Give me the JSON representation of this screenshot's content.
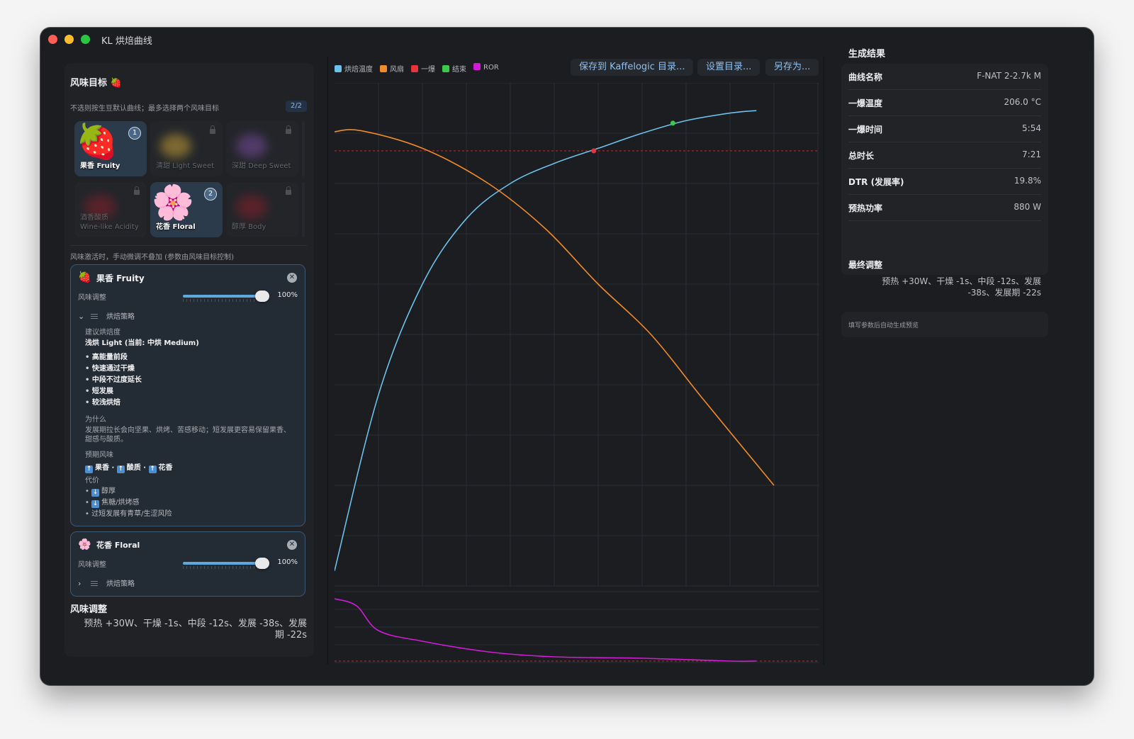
{
  "window": {
    "title": "KL 烘焙曲线"
  },
  "left": {
    "title": "风味目标",
    "title_emoji": "🍓",
    "hint": "不选则按生豆默认曲线；最多选择两个风味目标",
    "count": "2/2",
    "tiles": [
      {
        "label": "果香 Fruity",
        "emoji": "🍓",
        "state": "selected",
        "order": "1"
      },
      {
        "label": "清甜 Light Sweet",
        "state": "locked",
        "color": "#c9a23a"
      },
      {
        "label": "深甜 Deep Sweet",
        "state": "locked",
        "color": "#7a4fa0"
      },
      {
        "label_line1": "酒香酸质",
        "label_line2": "Wine-like Acidity",
        "state": "locked",
        "color": "#8a2230"
      },
      {
        "label": "花香 Floral",
        "emoji": "🌸",
        "state": "selected",
        "order": "2"
      },
      {
        "label": "醇厚 Body",
        "state": "locked",
        "color": "#8a2230"
      }
    ],
    "active_hint": "风味激活时，手动微调不叠加 (参数由风味目标控制)",
    "cards": {
      "fruity": {
        "emoji": "🍓",
        "title": "果香 Fruity",
        "slider_label": "风味调整",
        "slider_value": "100%",
        "strategy_label": "烘焙策略",
        "suggest_label": "建议烘焙度",
        "suggest_value": "浅烘 Light (当前: 中烘 Medium)",
        "bullets": [
          "高能量前段",
          "快速通过干燥",
          "中段不过度延长",
          "短发展",
          "较浅烘焙"
        ],
        "why_label": "为什么",
        "why_text": "发展期拉长会向坚果、烘烤、苦感移动；短发展更容易保留果香、甜感与酸质。",
        "expected_label": "预期风味",
        "expected": [
          "果香",
          "酸质",
          "花香"
        ],
        "cost_label": "代价",
        "costs": [
          "醇厚",
          "焦糖/烘烤感",
          "过短发展有青草/生涩风险"
        ]
      },
      "floral": {
        "emoji": "🌸",
        "title": "花香 Floral",
        "slider_label": "风味调整",
        "slider_value": "100%",
        "strategy_label": "烘焙策略"
      }
    },
    "adjust_title": "风味调整",
    "adjust_text": "预热 +30W、干燥 -1s、中段 -12s、发展 -38s、发展期 -22s"
  },
  "toolbar": {
    "legend": [
      {
        "label": "烘焙温度",
        "color": "#6cc0ec"
      },
      {
        "label": "风扇",
        "color": "#f08a2a"
      },
      {
        "label": "一爆",
        "color": "#e8333a"
      },
      {
        "label": "结束",
        "color": "#3cc84a"
      },
      {
        "label": "ROR",
        "color": "#d21ad8"
      }
    ],
    "save_kaffelogic": "保存到 Kaffelogic 目录...",
    "set_dir": "设置目录...",
    "save_as": "另存为..."
  },
  "chart_data": {
    "type": "line",
    "x_unit": "time",
    "x_grid_lines": 11,
    "total_time": "7:21",
    "first_crack_time": "5:54",
    "series": [
      {
        "name": "烘焙温度",
        "color": "#6cc0ec",
        "points": [
          [
            0,
            0.03
          ],
          [
            0.1,
            0.38
          ],
          [
            0.2,
            0.6
          ],
          [
            0.3,
            0.73
          ],
          [
            0.4,
            0.8
          ],
          [
            0.5,
            0.84
          ],
          [
            0.6,
            0.87
          ],
          [
            0.7,
            0.9
          ],
          [
            0.8,
            0.925
          ],
          [
            0.9,
            0.94
          ],
          [
            0.96,
            0.945
          ]
        ]
      },
      {
        "name": "风扇",
        "color": "#f08a2a",
        "points": [
          [
            0,
            0.903
          ],
          [
            0.06,
            0.905
          ],
          [
            0.2,
            0.87
          ],
          [
            0.35,
            0.8
          ],
          [
            0.48,
            0.71
          ],
          [
            0.6,
            0.6
          ],
          [
            0.72,
            0.5
          ],
          [
            0.84,
            0.37
          ],
          [
            1.0,
            0.2
          ]
        ]
      },
      {
        "name": "ROR",
        "color": "#d21ad8",
        "points": [
          [
            0,
            0.9
          ],
          [
            0.05,
            0.8
          ],
          [
            0.1,
            0.45
          ],
          [
            0.2,
            0.3
          ],
          [
            0.35,
            0.15
          ],
          [
            0.5,
            0.08
          ],
          [
            0.7,
            0.06
          ],
          [
            0.9,
            0.02
          ],
          [
            0.96,
            0.02
          ]
        ]
      }
    ],
    "markers": [
      {
        "name": "一爆",
        "color": "#e8333a",
        "x": 0.59,
        "y": 0.865
      },
      {
        "name": "结束",
        "color": "#3cc84a",
        "x": 0.77,
        "y": 0.92
      }
    ],
    "first_crack_reference_y": 0.865
  },
  "result": {
    "title": "生成结果",
    "rows": [
      {
        "k": "曲线名称",
        "v": "F-NAT 2-2.7k M"
      },
      {
        "k": "一爆温度",
        "v": "206.0 °C"
      },
      {
        "k": "一爆时间",
        "v": "5:54"
      },
      {
        "k": "总时长",
        "v": "7:21"
      },
      {
        "k": "DTR (发展率)",
        "v": "19.8%"
      },
      {
        "k": "预热功率",
        "v": "880 W"
      }
    ],
    "final_label": "最终调整",
    "final_value": "预热 +30W、干燥 -1s、中段 -12s、发展 -38s、发展期 -22s",
    "note": "填写参数后自动生成预览"
  }
}
